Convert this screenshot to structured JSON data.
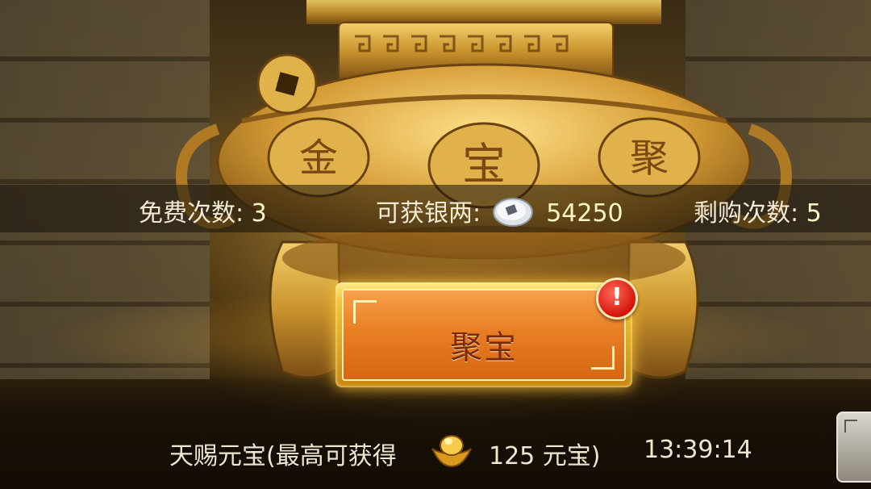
{
  "info_bar": {
    "free_label": "免费次数:",
    "free_value": "3",
    "silver_label": "可获银两:",
    "silver_value": "54250",
    "remain_label": "剩购次数:",
    "remain_value": "5"
  },
  "action_button": {
    "label": "聚宝",
    "badge": "!"
  },
  "footer": {
    "label": "天赐元宝(最高可获得",
    "amount": "125 元宝)",
    "timer": "13:39:14"
  },
  "cauldron_glyphs": [
    "金",
    "宝",
    "聚"
  ],
  "colors": {
    "accent_gold": "#f6c333",
    "button_orange": "#e97f25",
    "badge_red": "#d4140a"
  }
}
